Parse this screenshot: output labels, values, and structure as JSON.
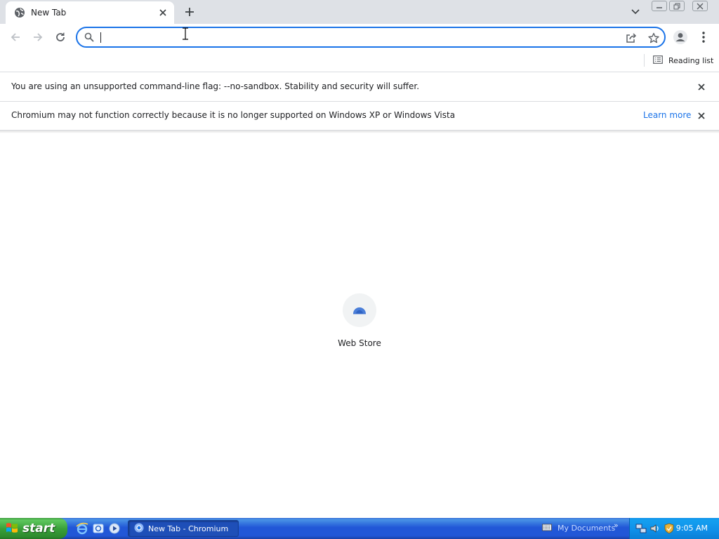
{
  "browser": {
    "tab": {
      "title": "New Tab"
    },
    "omnibox": {
      "value": "",
      "placeholder": ""
    },
    "bookmarks_bar": {
      "reading_list_label": "Reading list"
    }
  },
  "infobars": [
    {
      "text": "You are using an unsupported command-line flag: --no-sandbox. Stability and security will suffer.",
      "link": ""
    },
    {
      "text": "Chromium may not function correctly because it is no longer supported on Windows XP or Windows Vista",
      "link": "Learn more"
    }
  ],
  "new_tab_page": {
    "shortcuts": [
      {
        "title": "Web Store"
      }
    ]
  },
  "taskbar": {
    "start_label": "start",
    "tasks": [
      {
        "label": "New Tab - Chromium"
      }
    ],
    "toolbar_label": "My Documents",
    "clock": "9:05 AM"
  },
  "colors": {
    "accent": "#1a73e8",
    "tabstrip": "#dee1e6",
    "taskbar": "#2157d7",
    "start_button": "#3aa13a",
    "tray": "#0f8fe8"
  }
}
